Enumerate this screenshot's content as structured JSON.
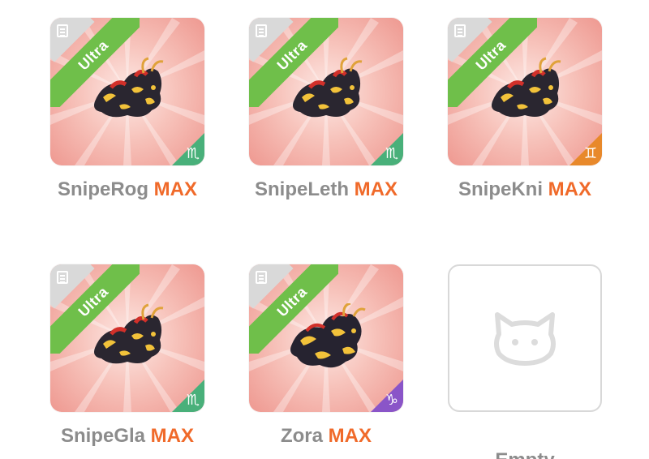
{
  "grid": {
    "cards": [
      {
        "name": "SnipeRog",
        "level": "MAX",
        "rarity": "Ultra",
        "zodiac_icon": "scorpio-icon",
        "zodiac_glyph": "♏",
        "zodiac_color": "#49b07a"
      },
      {
        "name": "SnipeLeth",
        "level": "MAX",
        "rarity": "Ultra",
        "zodiac_icon": "scorpio-icon",
        "zodiac_glyph": "♏",
        "zodiac_color": "#49b07a"
      },
      {
        "name": "SnipeKni",
        "level": "MAX",
        "rarity": "Ultra",
        "zodiac_icon": "gemini-icon",
        "zodiac_glyph": "♊",
        "zodiac_color": "#e8892b"
      },
      {
        "name": "SnipeGla",
        "level": "MAX",
        "rarity": "Ultra",
        "zodiac_icon": "scorpio-icon",
        "zodiac_glyph": "♏",
        "zodiac_color": "#49b07a"
      },
      {
        "name": "Zora",
        "level": "MAX",
        "rarity": "Ultra",
        "zodiac_icon": "capricorn-icon",
        "zodiac_glyph": "♑",
        "zodiac_color": "#8a55c8"
      }
    ],
    "empty_slot": {
      "label": "Empty",
      "icon": "cat-face-icon"
    }
  },
  "colors": {
    "max_label": "#f06a2a",
    "name_label": "#8c8c8c",
    "rarity_ribbon": "#6fbf4a",
    "card_bg": "#f4b3aa"
  }
}
